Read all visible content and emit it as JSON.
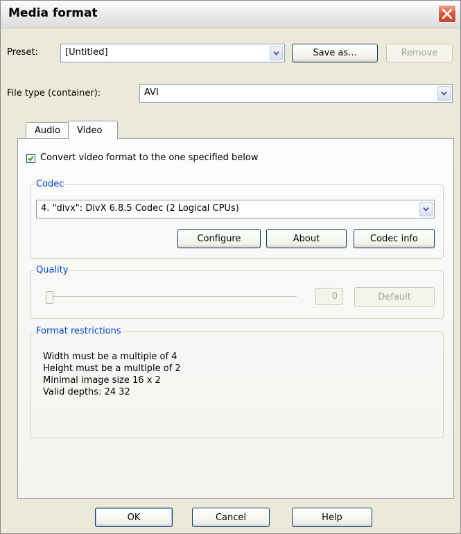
{
  "window": {
    "title": "Media format"
  },
  "preset": {
    "label": "Preset:",
    "value": "[Untitled]",
    "save_as": "Save as...",
    "remove": "Remove"
  },
  "file_type": {
    "label": "File type (container):",
    "value": "AVI"
  },
  "tabs": [
    {
      "label": "Audio"
    },
    {
      "label": "Video",
      "active": true
    }
  ],
  "video": {
    "convert_checkbox": {
      "label": "Convert video format to the one specified below",
      "checked": true
    },
    "codec": {
      "group_label": "Codec",
      "value": "4. \"divx\": DivX 6.8.5 Codec (2 Logical CPUs)",
      "configure": "Configure",
      "about": "About",
      "codec_info": "Codec info"
    },
    "quality": {
      "group_label": "Quality",
      "value": "0",
      "default": "Default",
      "slider_fraction": 0
    },
    "restrictions": {
      "group_label": "Format restrictions",
      "lines": [
        "Width must be a multiple of 4",
        "Height must be a multiple of 2",
        "Minimal image size 16 x 2",
        "Valid depths:  24 32"
      ]
    }
  },
  "buttons": {
    "ok": "OK",
    "cancel": "Cancel",
    "help": "Help"
  },
  "colors": {
    "accent": "#0046d5",
    "close": "#d4593b",
    "face": "#ece9d8"
  }
}
